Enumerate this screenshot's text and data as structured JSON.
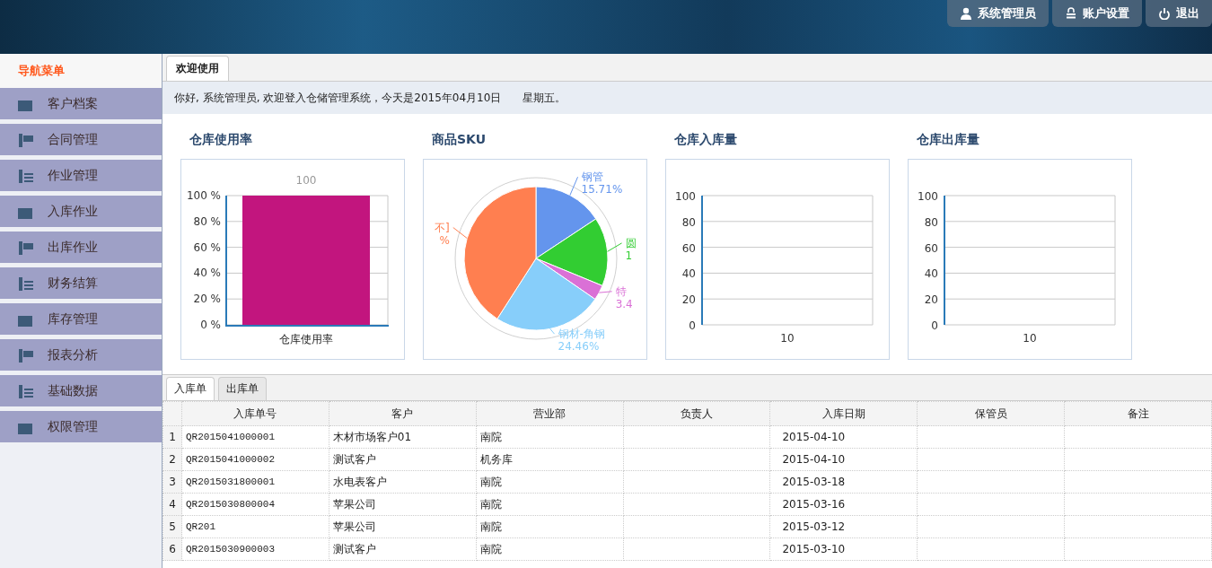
{
  "header": {
    "buttons": [
      {
        "kind": "user",
        "label": "系统管理员"
      },
      {
        "kind": "lock",
        "label": "账户设置"
      },
      {
        "kind": "power",
        "label": "退出"
      }
    ]
  },
  "sidebar": {
    "title": "导航菜单",
    "items": [
      {
        "label": "客户档案",
        "selected": false
      },
      {
        "label": "合同管理",
        "selected": false
      },
      {
        "label": "作业管理",
        "selected": false
      },
      {
        "label": "入库作业",
        "selected": false
      },
      {
        "label": "出库作业",
        "selected": false
      },
      {
        "label": "财务结算",
        "selected": false
      },
      {
        "label": "库存管理",
        "selected": false
      },
      {
        "label": "报表分析",
        "selected": false
      },
      {
        "label": "基础数据",
        "selected": false
      },
      {
        "label": "权限管理",
        "selected": false
      }
    ]
  },
  "tabs": [
    {
      "label": "欢迎使用",
      "selected": true
    }
  ],
  "greeting": {
    "text": "你好, 系统管理员, 欢迎登入仓储管理系统，今天是2015年04月10日",
    "weekday": "星期五。"
  },
  "charts": [
    {
      "title": "仓库使用率",
      "chart_data": {
        "type": "bar",
        "categories": [
          "仓库使用率"
        ],
        "values": [
          100
        ],
        "grid": true,
        "ylim": [
          0,
          100
        ],
        "yticks": [
          {
            "value": 0,
            "label": "0 %"
          },
          {
            "value": 20,
            "label": "20 %"
          },
          {
            "value": 40,
            "label": "40 %"
          },
          {
            "value": 60,
            "label": "60 %"
          },
          {
            "value": 80,
            "label": "80 %"
          },
          {
            "value": 100,
            "label": "100 %"
          }
        ],
        "color": "#c2157e",
        "value_labels": [
          "100"
        ]
      }
    },
    {
      "title": "商品SKU",
      "chart_data": {
        "type": "pie",
        "categories": [
          "钢管",
          "圆",
          "特",
          "钢材-角钢",
          "不]"
        ],
        "values": [
          15.71,
          15.5,
          3.4,
          24.46,
          40.93
        ],
        "colors": [
          "#6495ed",
          "#32cd32",
          "#da70d6",
          "#87cefa",
          "#ff7f50"
        ]
      },
      "slice_labels": [
        "15.71%",
        "1",
        "3.4",
        "24.46%",
        "%"
      ]
    },
    {
      "title": "仓库入库量",
      "chart_data": {
        "type": "line",
        "categories": [
          "10"
        ],
        "values": [
          null
        ],
        "grid": true,
        "ylim": [
          0,
          100
        ],
        "yticks": [
          0,
          20,
          40,
          60,
          80,
          100
        ]
      }
    },
    {
      "title": "仓库出库量",
      "chart_data": {
        "type": "line",
        "categories": [
          "10"
        ],
        "values": [
          null
        ],
        "grid": true,
        "ylim": [
          0,
          100
        ],
        "yticks": [
          0,
          20,
          40,
          60,
          80,
          100
        ]
      }
    }
  ],
  "bottom_tabs": [
    {
      "label": "入库单",
      "selected": true
    },
    {
      "label": "出库单",
      "selected": false
    }
  ],
  "table": {
    "columns": [
      "入库单号",
      "客户",
      "营业部",
      "负责人",
      "入库日期",
      "保管员",
      "备注"
    ],
    "rows": [
      {
        "num": "1",
        "cells": [
          "QR2015041000001",
          "木材市场客户01",
          "南院",
          "",
          "2015-04-10",
          "",
          ""
        ]
      },
      {
        "num": "2",
        "cells": [
          "QR2015041000002",
          "测试客户",
          "机务库",
          "",
          "2015-04-10",
          "",
          ""
        ]
      },
      {
        "num": "3",
        "cells": [
          "QR2015031800001",
          "水电表客户",
          "南院",
          "",
          "2015-03-18",
          "",
          ""
        ]
      },
      {
        "num": "4",
        "cells": [
          "QR2015030800004",
          "苹果公司",
          "南院",
          "",
          "2015-03-16",
          "",
          ""
        ]
      },
      {
        "num": "5",
        "cells": [
          "QR201",
          "苹果公司",
          "南院",
          "",
          "2015-03-12",
          "",
          ""
        ]
      },
      {
        "num": "6",
        "cells": [
          "QR2015030900003",
          "测试客户",
          "南院",
          "",
          "2015-03-10",
          "",
          ""
        ]
      }
    ]
  }
}
